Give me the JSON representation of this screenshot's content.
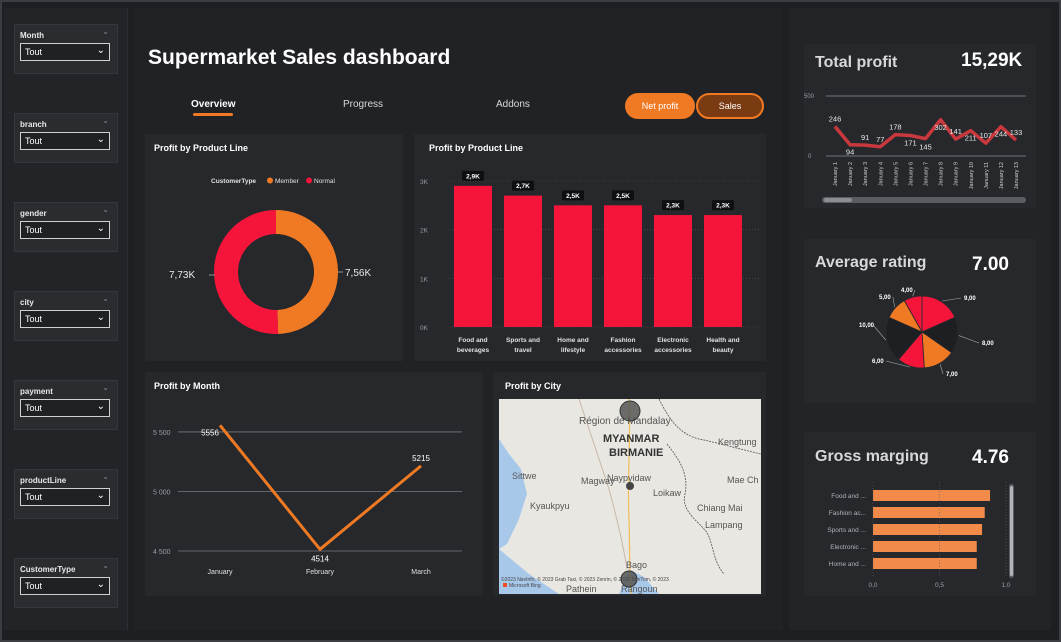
{
  "slicers": [
    {
      "label": "Month",
      "value": "Tout"
    },
    {
      "label": "branch",
      "value": "Tout"
    },
    {
      "label": "gender",
      "value": "Tout"
    },
    {
      "label": "city",
      "value": "Tout"
    },
    {
      "label": "payment",
      "value": "Tout"
    },
    {
      "label": "productLine",
      "value": "Tout"
    },
    {
      "label": "CustomerType",
      "value": "Tout"
    }
  ],
  "header": {
    "title": "Supermarket Sales dashboard",
    "tabs": [
      "Overview",
      "Progress",
      "Addons"
    ],
    "buttons": {
      "net_profit": "Net profit",
      "sales": "Sales"
    }
  },
  "colors": {
    "accent": "#f07a23",
    "red": "#f5153a",
    "bg": "#1d1f22",
    "card": "#26282c",
    "line_red": "#c8383d"
  },
  "donut": {
    "title": "Profit by Product Line",
    "legend_title": "CustomerType",
    "legend": [
      "Member",
      "Normal"
    ],
    "labels": [
      "7,73K",
      "7,56K"
    ]
  },
  "bar_card": {
    "title": "Profit by Product Line"
  },
  "line_card": {
    "title": "Profit by Month"
  },
  "map_card": {
    "title": "Profit by City",
    "labels": {
      "region": "Région de Mandalay",
      "country1": "MYANMAR",
      "country2": "BIRMANIE",
      "kengtung": "Kengtung",
      "sittwe": "Sittwe",
      "magway": "Magway",
      "naypyidaw": "Naypyidaw",
      "loikaw": "Loikaw",
      "maechan": "Mae Ch",
      "kyaukpyu": "Kyaukpyu",
      "chiangmai": "Chiang Mai",
      "lampang": "Lampang",
      "bago": "Bago",
      "pathein": "Pathein",
      "rangoon": "Rangoun",
      "attribution": "©2023 NavInfo, © 2023 Grab Taxi, © 2023 Zenrin, © 2023 TomTom, © 2023",
      "bing": "Microsoft Bing"
    }
  },
  "kpis": {
    "total_profit": {
      "title": "Total profit",
      "value": "15,29K"
    },
    "avg_rating": {
      "title": "Average rating",
      "value": "7.00"
    },
    "gross": {
      "title": "Gross marging",
      "value": "4.76"
    }
  },
  "chart_data": [
    {
      "type": "pie",
      "title": "Profit by Product Line",
      "legend_title": "CustomerType",
      "categories": [
        "Member",
        "Normal"
      ],
      "values": [
        7560,
        7730
      ],
      "colors": [
        "#f07a23",
        "#f5153a"
      ]
    },
    {
      "type": "bar",
      "title": "Profit by Product Line",
      "categories": [
        "Food and beverages",
        "Sports and travel",
        "Home and lifestyle",
        "Fashion accessories",
        "Electronic accessories",
        "Health and beauty"
      ],
      "values": [
        2900,
        2700,
        2500,
        2500,
        2300,
        2300
      ],
      "data_labels": [
        "2,9K",
        "2,7K",
        "2,5K",
        "2,5K",
        "2,3K",
        "2,3K"
      ],
      "yticks": [
        "0K",
        "1K",
        "2K",
        "3K"
      ],
      "ylim": [
        0,
        3000
      ],
      "grid": true
    },
    {
      "type": "line",
      "title": "Profit by Month",
      "categories": [
        "January",
        "February",
        "March"
      ],
      "values": [
        5556,
        4514,
        5215
      ],
      "yticks": [
        "4 500",
        "5 000",
        "5 500"
      ],
      "ylim": [
        4500,
        5550
      ],
      "grid": true
    },
    {
      "type": "line",
      "title": "Total profit",
      "categories": [
        "January 1",
        "January 2",
        "January 3",
        "January 4",
        "January 5",
        "January 6",
        "January 7",
        "January 8",
        "January 9",
        "January 10",
        "January 11",
        "January 12",
        "January 13"
      ],
      "values": [
        246,
        94,
        91,
        77,
        178,
        171,
        145,
        302,
        141,
        211,
        107,
        244,
        133
      ],
      "yticks": [
        "0",
        "500"
      ],
      "ylim": [
        0,
        500
      ]
    },
    {
      "type": "pie",
      "title": "Average rating",
      "values": [
        9.0,
        8.0,
        7.0,
        6.0,
        10.0,
        5.0,
        4.0
      ],
      "labels": [
        "9,00",
        "8,00",
        "7,00",
        "6,00",
        "10,00",
        "5,00",
        "4,00"
      ],
      "colors": [
        "#f5153a",
        "#1d1f22",
        "#f07a23",
        "#f5153a",
        "#1d1f22",
        "#f07a23",
        "#f5153a"
      ]
    },
    {
      "type": "bar",
      "title": "Gross marging",
      "orientation": "horizontal",
      "categories": [
        "Food and ...",
        "Fashion ac...",
        "Sports and ...",
        "Electronic ...",
        "Home and ..."
      ],
      "values": [
        0.88,
        0.84,
        0.82,
        0.78,
        0.78
      ],
      "xticks": [
        "0,0",
        "0,5",
        "1,0"
      ],
      "xlim": [
        0,
        1
      ]
    }
  ]
}
